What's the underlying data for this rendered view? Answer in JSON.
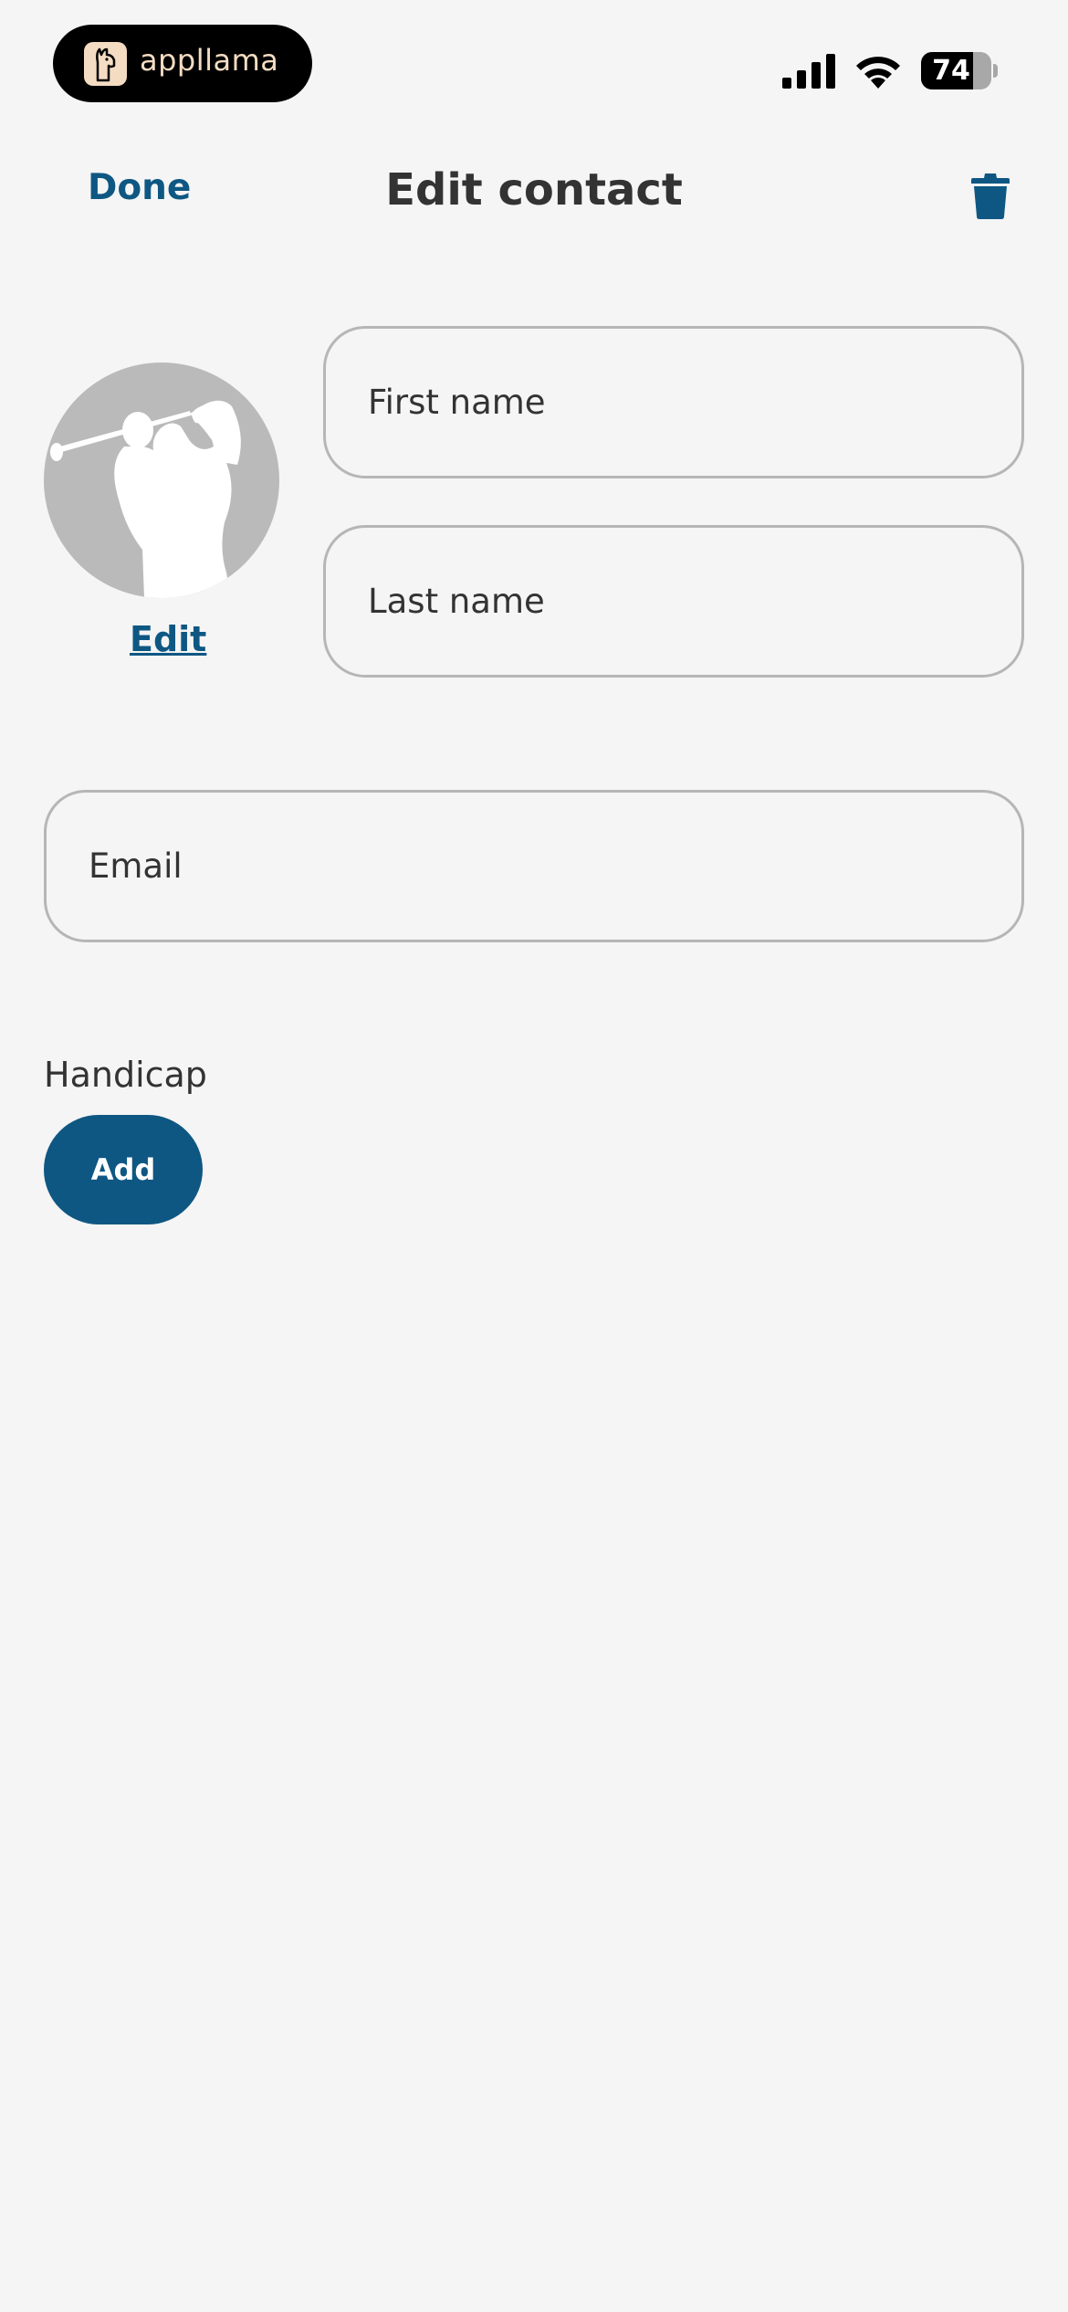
{
  "status_bar": {
    "brand": "appllama",
    "battery_level": 74,
    "battery_text": "74",
    "icons": [
      "appllama-logo-icon",
      "signal-icon",
      "wifi-icon",
      "battery-icon"
    ]
  },
  "header": {
    "done_label": "Done",
    "title": "Edit contact",
    "delete_icon": "trash-icon"
  },
  "avatar": {
    "icon": "golfer-silhouette-icon",
    "edit_label": "Edit"
  },
  "form": {
    "first_name": {
      "value": "",
      "placeholder": "First name"
    },
    "last_name": {
      "value": "",
      "placeholder": "Last name"
    },
    "email": {
      "value": "",
      "placeholder": "Email"
    }
  },
  "handicap": {
    "label": "Handicap",
    "add_label": "Add"
  },
  "colors": {
    "accent": "#0f5783",
    "background": "#f5f5f5",
    "text": "#333333",
    "border": "#b6b6b6",
    "avatar_bg": "#bababa"
  }
}
